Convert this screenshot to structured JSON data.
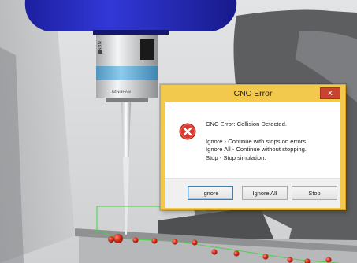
{
  "dialog": {
    "title": "CNC Error",
    "close_label": "x",
    "message": {
      "error_line": "CNC Error: Collision Detected.",
      "ignore_line": "Ignore - Continue with stops on errors.",
      "ignore_all_line": "Ignore All - Continue without stopping.",
      "stop_line": "Stop - Stop simulation."
    },
    "buttons": {
      "ignore": "Ignore",
      "ignore_all": "Ignore All",
      "stop": "Stop"
    },
    "icon": "error-x-icon"
  },
  "scene": {
    "probe_brand": "RENISHAW",
    "colors": {
      "spindle_blue": "#2a2fc4",
      "probe_band": "#6fb3d9",
      "contact_points": "#d9301f",
      "path_green": "#4ad14a",
      "dialog_frame": "#f2c94c"
    }
  }
}
